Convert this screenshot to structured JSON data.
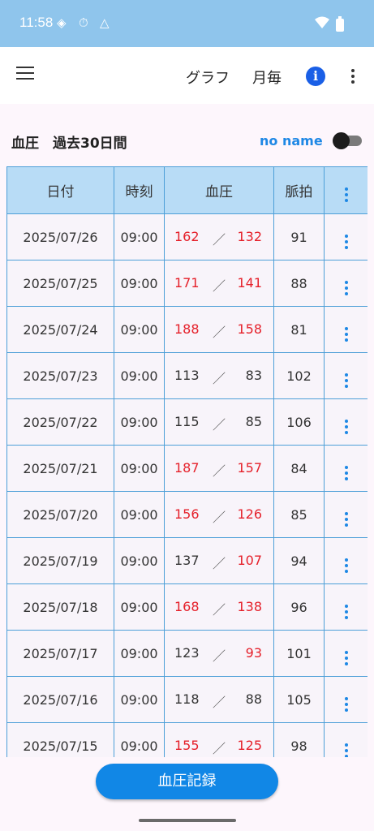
{
  "status_bar": {
    "time": "11:58"
  },
  "app_bar": {
    "graph_label": "グラフ",
    "monthly_label": "月毎"
  },
  "section": {
    "title": "血圧　過去30日間",
    "user_name": "no name"
  },
  "table": {
    "headers": {
      "date": "日付",
      "time": "時刻",
      "bp": "血圧",
      "pulse": "脈拍"
    },
    "separator": "／",
    "rows": [
      {
        "date": "2025/07/26",
        "time": "09:00",
        "systolic": "162",
        "diastolic": "132",
        "pulse": "91",
        "sys_high": true,
        "dia_high": true
      },
      {
        "date": "2025/07/25",
        "time": "09:00",
        "systolic": "171",
        "diastolic": "141",
        "pulse": "88",
        "sys_high": true,
        "dia_high": true
      },
      {
        "date": "2025/07/24",
        "time": "09:00",
        "systolic": "188",
        "diastolic": "158",
        "pulse": "81",
        "sys_high": true,
        "dia_high": true
      },
      {
        "date": "2025/07/23",
        "time": "09:00",
        "systolic": "113",
        "diastolic": "83",
        "pulse": "102",
        "sys_high": false,
        "dia_high": false
      },
      {
        "date": "2025/07/22",
        "time": "09:00",
        "systolic": "115",
        "diastolic": "85",
        "pulse": "106",
        "sys_high": false,
        "dia_high": false
      },
      {
        "date": "2025/07/21",
        "time": "09:00",
        "systolic": "187",
        "diastolic": "157",
        "pulse": "84",
        "sys_high": true,
        "dia_high": true
      },
      {
        "date": "2025/07/20",
        "time": "09:00",
        "systolic": "156",
        "diastolic": "126",
        "pulse": "85",
        "sys_high": true,
        "dia_high": true
      },
      {
        "date": "2025/07/19",
        "time": "09:00",
        "systolic": "137",
        "diastolic": "107",
        "pulse": "94",
        "sys_high": false,
        "dia_high": true
      },
      {
        "date": "2025/07/18",
        "time": "09:00",
        "systolic": "168",
        "diastolic": "138",
        "pulse": "96",
        "sys_high": true,
        "dia_high": true
      },
      {
        "date": "2025/07/17",
        "time": "09:00",
        "systolic": "123",
        "diastolic": "93",
        "pulse": "101",
        "sys_high": false,
        "dia_high": true
      },
      {
        "date": "2025/07/16",
        "time": "09:00",
        "systolic": "118",
        "diastolic": "88",
        "pulse": "105",
        "sys_high": false,
        "dia_high": false
      },
      {
        "date": "2025/07/15",
        "time": "09:00",
        "systolic": "155",
        "diastolic": "125",
        "pulse": "98",
        "sys_high": true,
        "dia_high": true
      }
    ]
  },
  "record_button": {
    "label": "血圧記録"
  },
  "colors": {
    "accent": "#1187e6",
    "high_value": "#e5202a",
    "header_bg": "#b8dcf6",
    "status_bar": "#8fc5ec"
  }
}
